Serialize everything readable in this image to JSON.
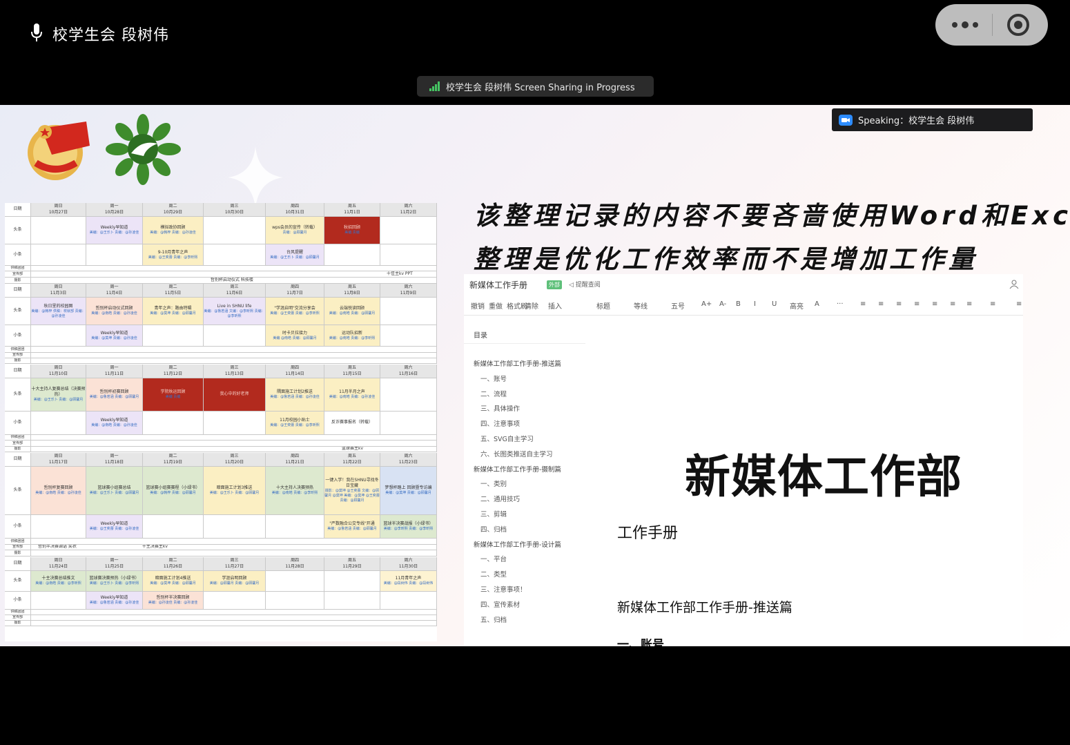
{
  "call": {
    "caller_name": "校学生会 段树伟",
    "share_banner": "校学生会 段树伟 Screen Sharing in Progress",
    "speaking": "Speaking：校学生会 段树伟",
    "icons": [
      "microphone-icon",
      "more-icon",
      "target-icon",
      "signal-bars-icon",
      "zoom-camera-icon"
    ]
  },
  "headline": {
    "line1": "该整理记录的内容不要吝啬使用Word和Excel",
    "line2": "整理是优化工作效率而不是增加工作量"
  },
  "schedule": {
    "row_labels": [
      "日期",
      "头条",
      "小条",
      "供稿团团",
      "宣传部",
      "摄影"
    ],
    "weekdays": [
      "周日",
      "周一",
      "周二",
      "周三",
      "周四",
      "周五",
      "周六"
    ],
    "weeks": [
      {
        "dates": [
          "10月27日",
          "10月28日",
          "10月29日",
          "10月30日",
          "10月31日",
          "11月1日",
          "11月2日"
        ],
        "headline": [
          {
            "t": "",
            "c": ""
          },
          {
            "t": "Weekly早知道",
            "b": "美编：@王乐卜 责编：@孙凌佳",
            "c": "c-purple"
          },
          {
            "t": "模拟政协回顾",
            "b": "美编：@韩梓 责编：@孙凌佳",
            "c": "c-yellow"
          },
          {
            "t": "",
            "c": ""
          },
          {
            "t": "wps会员的宣传（转载）",
            "b": "责编：@顾馨月",
            "c": "c-yellow"
          },
          {
            "t": "秋招回顾",
            "b": "美编 责编",
            "c": "c-red"
          },
          {
            "t": "",
            "c": ""
          }
        ],
        "minor": [
          {
            "t": "",
            "c": ""
          },
          {
            "t": "",
            "c": ""
          },
          {
            "t": "9-10月青年之声",
            "b": "美编：@王奕蕾 责编：@李昕熙",
            "c": "c-yellow"
          },
          {
            "t": "",
            "c": ""
          },
          {
            "t": "台风提醒",
            "b": "美编：@王乐卜 责编：@顾馨月",
            "c": "c-purple"
          },
          {
            "t": "",
            "c": ""
          },
          {
            "t": "",
            "c": ""
          }
        ],
        "xuan": "十佳主kv PPT",
        "she": "哲别杯启动仪式 科技楼"
      },
      {
        "dates": [
          "11月3日",
          "11月4日",
          "11月5日",
          "11月6日",
          "11月7日",
          "11月8日",
          "11月9日"
        ],
        "headline": [
          {
            "t": "秋日里的校园图",
            "b": "美编：@韩梓 供稿：校就部 责编：@孙凌佳",
            "c": "c-purple"
          },
          {
            "t": "哲别杯启动仪式回顾",
            "b": "美编：@南皓 责编：@孙凌佳",
            "c": "c-pink"
          },
          {
            "t": "青年之声：路由特辑",
            "b": "美编：@莫坤 责编：@顾馨月",
            "c": "c-yellow"
          },
          {
            "t": "Live in SHNU life",
            "b": "美编：@鲁若涵 文编：@李昕熙 责编：@李昕熙",
            "c": "c-purple"
          },
          {
            "t": "\"学涯启明\"交流分享会",
            "b": "美编：@王奕蕾 责编：@李昕熙",
            "c": "c-yellow"
          },
          {
            "t": "云端悦读回顾",
            "b": "美编：@南皓 责编：@顾馨月",
            "c": "c-yellow"
          },
          {
            "t": "",
            "c": ""
          }
        ],
        "minor": [
          {
            "t": "",
            "c": ""
          },
          {
            "t": "Weekly早知道",
            "b": "美编：@莫坤 责编：@孙凌佳",
            "c": "c-purple"
          },
          {
            "t": "",
            "c": ""
          },
          {
            "t": "",
            "c": ""
          },
          {
            "t": "时卡贝拉接力",
            "b": "美编 @南皓 责编：@顾馨月",
            "c": "c-yellow"
          },
          {
            "t": "运动队招新",
            "b": "美编：@南皓 责编：@李昕熙",
            "c": "c-yellow"
          },
          {
            "t": "",
            "c": ""
          }
        ],
        "xuan": "",
        "she": ""
      },
      {
        "dates": [
          "11月10日",
          "11月11日",
          "11月12日",
          "11月13日",
          "11月14日",
          "11月15日",
          "11月16日"
        ],
        "headline": [
          {
            "t": "十大主持人复赛总结（决赛预热）",
            "b": "美编：@王乐卜 责编：@顾馨月",
            "c": "c-green"
          },
          {
            "t": "哲别杯初赛回顾",
            "b": "美编：@鲁若涵 责编：@顾馨月",
            "c": "c-pink"
          },
          {
            "t": "学院秋运回顾",
            "b": "美编 责编",
            "c": "c-red"
          },
          {
            "t": "我心中的好老师",
            "c": "c-red"
          },
          {
            "t": "隅面施工计划2推送",
            "b": "美编：@鲁若涵 责编：@孙凌佳",
            "c": "c-yellow"
          },
          {
            "t": "11月半月之声",
            "b": "美编：@南皓 责编：@孙凌佳",
            "c": "c-yellow"
          },
          {
            "t": "",
            "c": ""
          }
        ],
        "minor": [
          {
            "t": "",
            "c": ""
          },
          {
            "t": "Weekly早知道",
            "b": "美编：@南皓 责编：@孙凌佳",
            "c": "c-purple"
          },
          {
            "t": "",
            "c": ""
          },
          {
            "t": "",
            "c": ""
          },
          {
            "t": "11月校园小贴士",
            "b": "美编：@王奕蕾 责编：@李昕熙",
            "c": "c-yellow"
          },
          {
            "t": "反诈赛事报名（转载）",
            "c": ""
          },
          {
            "t": "",
            "c": ""
          }
        ],
        "xuan": "",
        "she": "篮球赛主kv"
      },
      {
        "dates": [
          "11月17日",
          "11月18日",
          "11月19日",
          "11月20日",
          "11月21日",
          "11月22日",
          "11月23日"
        ],
        "headline": [
          {
            "t": "哲别杯复赛回顾",
            "b": "美编：@南皓 责编：@孙凌佳",
            "c": "c-pink"
          },
          {
            "t": "篮球赛小组赛总结",
            "b": "美编：@王乐卜 责编：@顾馨月",
            "c": "c-green"
          },
          {
            "t": "篮球赛小组赛赛程（小绿书）",
            "b": "美编：@韩梓 责编：@顾馨月",
            "c": "c-green"
          },
          {
            "t": "暗面施工计划3推送",
            "b": "美编：@王乐卜 责编：@顾馨月",
            "c": "c-yellow"
          },
          {
            "t": "十大主持人决赛预热",
            "b": "美编：@南皓 责编：@李昕熙",
            "c": "c-green"
          },
          {
            "t": "一键入学！我在SHNU寻找冬日宝藏",
            "b": "摄影：@莫坤 @王奕蕾 文编：@顾馨月 @莫坤 美编：@莫坤 @王奕蕾 责编：@顾馨月",
            "c": "c-yellow"
          },
          {
            "t": "梦想杯踏上 回顾暨专访编",
            "b": "美编：@莫坤 责编：@顾馨月",
            "c": "c-blue"
          }
        ],
        "minor": [
          {
            "t": "",
            "c": ""
          },
          {
            "t": "Weekly早知道",
            "b": "美编：@王奕蕾 责编：@孙凌佳",
            "c": "c-purple"
          },
          {
            "t": "",
            "c": ""
          },
          {
            "t": "",
            "c": ""
          },
          {
            "t": "",
            "c": ""
          },
          {
            "t": "\"严数融合公交专线\"开通",
            "b": "美编：@鲁若涵 责编：@顾馨月",
            "c": "c-yellow"
          },
          {
            "t": "篮球半决赛战报（小绿书）",
            "b": "美编：@李昕熙 责编：@李昕熙",
            "c": "c-green"
          }
        ],
        "xuan": "十主决赛主kv",
        "xuan0": "哲别半决赛调语 奖状",
        "she": ""
      },
      {
        "dates": [
          "11月24日",
          "11月25日",
          "11月26日",
          "11月27日",
          "11月28日",
          "11月29日",
          "11月30日"
        ],
        "headline": [
          {
            "t": "十主决赛总结推文",
            "b": "美编：@南皓 责编：@李昕熙",
            "c": "c-green"
          },
          {
            "t": "篮球赛决赛预热（小绿书）",
            "b": "美编：@王乐卜 责编：@李昕熙",
            "c": "c-green"
          },
          {
            "t": "暗面施工计划4推送",
            "b": "美编：@莫坤 责编：@顾馨月",
            "c": "c-yellow"
          },
          {
            "t": "学涯启明回顾",
            "b": "美编：@顾馨月 责编：@顾馨月",
            "c": "c-yellow"
          },
          {
            "t": "",
            "c": ""
          },
          {
            "t": "",
            "c": ""
          },
          {
            "t": "11月青年之声",
            "b": "美编：@段树伟 责编：@段树伟",
            "c": "c-lyellow"
          }
        ],
        "minor": [
          {
            "t": "",
            "c": ""
          },
          {
            "t": "Weekly早知道",
            "b": "美编：@鲁若涵 责编：@孙凌佳",
            "c": "c-purple"
          },
          {
            "t": "哲别杯半决赛回顾",
            "b": "美编：@孙凌佳 责编：@孙凌佳",
            "c": "c-pink"
          },
          {
            "t": "",
            "c": ""
          },
          {
            "t": "",
            "c": ""
          },
          {
            "t": "",
            "c": ""
          },
          {
            "t": "",
            "c": ""
          }
        ],
        "xuan": "",
        "she": ""
      }
    ]
  },
  "doc": {
    "title": "新媒体工作手册",
    "tag": "外部",
    "remind": "提醒查阅",
    "toolbar": [
      "撤销",
      "重做",
      "格式刷",
      "清除",
      "插入",
      "标题",
      "等线",
      "五号",
      "A+",
      "A-",
      "B",
      "I",
      "U",
      "高亮",
      "A",
      "···"
    ],
    "toc_heading": "目录",
    "toc": [
      {
        "label": "新媒体工作部工作手册-推送篇",
        "level": 1
      },
      {
        "label": "一、账号",
        "level": 2
      },
      {
        "label": "二、流程",
        "level": 2
      },
      {
        "label": "三、具体操作",
        "level": 2
      },
      {
        "label": "四、注意事项",
        "level": 2
      },
      {
        "label": "五、SVG自主学习",
        "level": 2
      },
      {
        "label": "六、长图类推送自主学习",
        "level": 2
      },
      {
        "label": "新媒体工作部工作手册-摄制篇",
        "level": 1
      },
      {
        "label": "一、类别",
        "level": 2
      },
      {
        "label": "二、通用技巧",
        "level": 2
      },
      {
        "label": "三、剪辑",
        "level": 2
      },
      {
        "label": "四、归档",
        "level": 2
      },
      {
        "label": "新媒体工作部工作手册-设计篇",
        "level": 1
      },
      {
        "label": "一、平台",
        "level": 2
      },
      {
        "label": "二、类型",
        "level": 2
      },
      {
        "label": "三、注意事项！",
        "level": 2
      },
      {
        "label": "四、宣传素材",
        "level": 2
      },
      {
        "label": "五、归档",
        "level": 2
      }
    ],
    "big_title": "新媒体工作部",
    "subtitle": "工作手册",
    "section_heading": "新媒体工作部工作手册-推送篇",
    "next_heading": "一、账号"
  }
}
